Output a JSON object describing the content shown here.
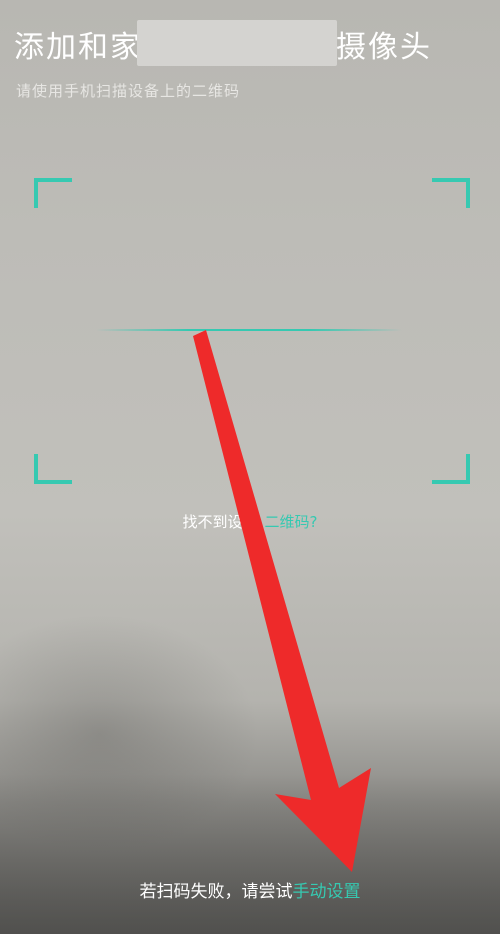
{
  "header": {
    "title_prefix": "添加和家",
    "title_suffix": "摄像头",
    "subtitle": "请使用手机扫描设备上的二维码"
  },
  "scanner": {
    "help_text_white": "找不到设",
    "help_text_accent": "二维码?"
  },
  "footer": {
    "tip_text": "若扫码失败，请尝试",
    "manual_link": "手动设置"
  },
  "colors": {
    "accent": "#36c9b1",
    "annotation_arrow": "#ee2a2a"
  }
}
